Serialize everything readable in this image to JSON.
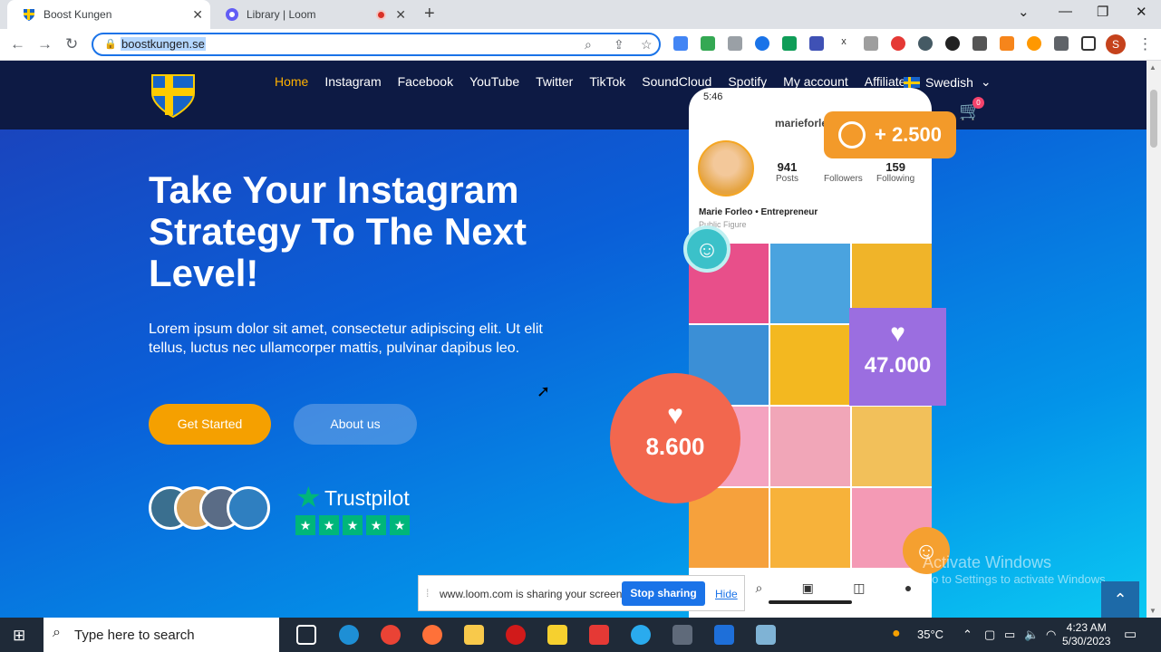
{
  "browser": {
    "tabs": [
      {
        "title": "Boost Kungen",
        "active": true,
        "favicon": "swedish-crest-icon"
      },
      {
        "title": "Library | Loom",
        "active": false,
        "favicon": "loom-icon"
      }
    ],
    "address": "boostkungen.se"
  },
  "site": {
    "menu": [
      "Home",
      "Instagram",
      "Facebook",
      "YouTube",
      "Twitter",
      "TikTok",
      "SoundCloud",
      "Spotify",
      "My account",
      "Affiliate"
    ],
    "language": "Swedish",
    "cart_count": "0",
    "hero_title": "Take Your Instagram Strategy To The Next Level!",
    "hero_text": "Lorem ipsum dolor sit amet, consectetur adipiscing elit. Ut elit tellus, luctus nec ullamcorper mattis, pulvinar dapibus leo.",
    "btn_start": "Get Started",
    "btn_about": "About us",
    "trustpilot": "Trustpilot"
  },
  "phone": {
    "time": "5:46",
    "username": "marieforleo",
    "posts": {
      "value": "941",
      "label": "Posts"
    },
    "followers": {
      "value": "+ 2.500",
      "label": "Followers"
    },
    "following": {
      "value": "159",
      "label": "Following"
    },
    "name": "Marie Forleo • Entrepreneur",
    "role": "Public Figure",
    "likes_card": "47.000",
    "red_circle": "8.600"
  },
  "watermark": {
    "title": "Activate Windows",
    "sub": "Go to Settings to activate Windows."
  },
  "loom_bar": {
    "text": "www.loom.com is sharing your screen.",
    "stop": "Stop sharing",
    "hide": "Hide"
  },
  "taskbar": {
    "search_placeholder": "Type here to search",
    "temperature": "35°C",
    "time": "4:23 AM",
    "date": "5/30/2023"
  },
  "colors": {
    "accent_orange": "#f5a000",
    "menu_active": "#ffb100",
    "trustpilot_green": "#00b67a",
    "chrome_focus": "#1a73e8"
  }
}
